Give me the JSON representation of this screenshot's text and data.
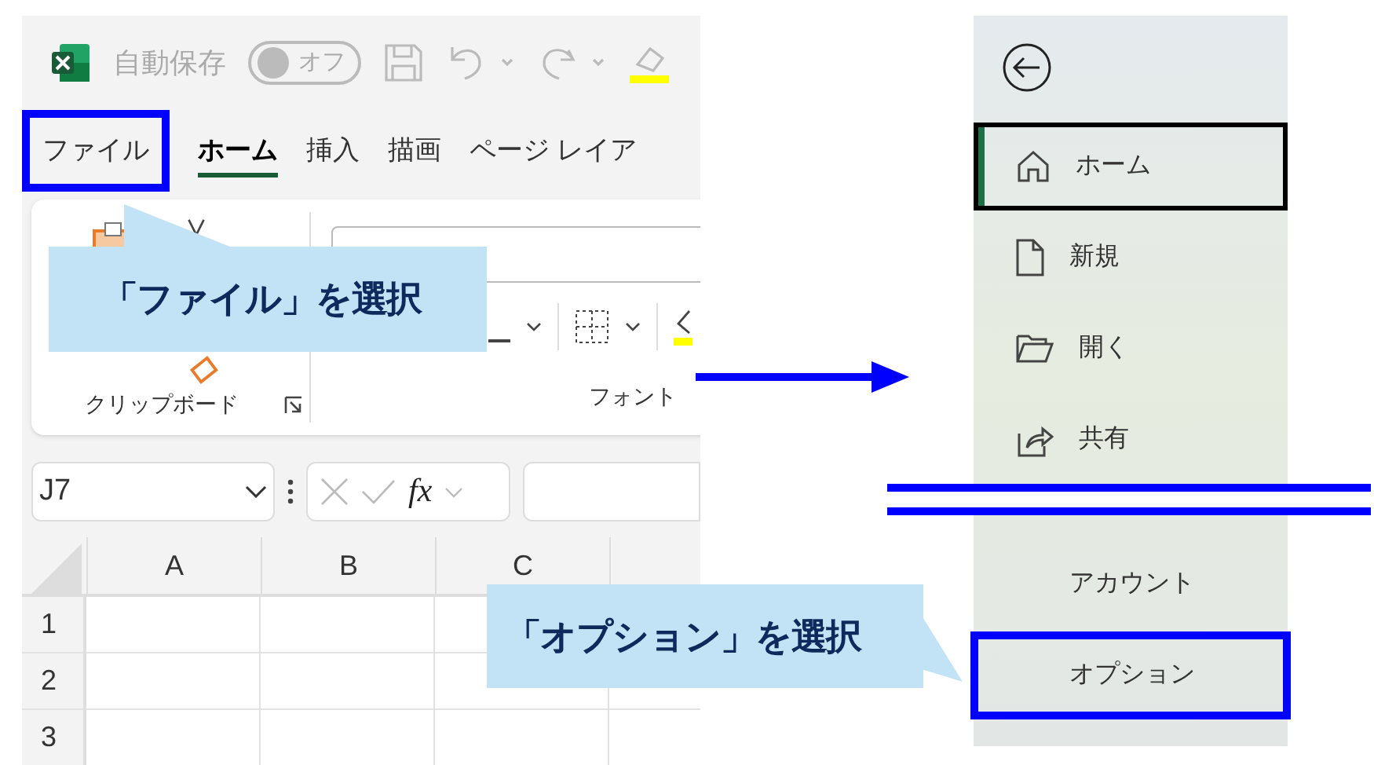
{
  "excel": {
    "autosave": {
      "label": "自動保存",
      "toggle": "オフ",
      "on": false
    },
    "tabs": [
      {
        "label": "ファイル",
        "selected": false,
        "highlighted": true
      },
      {
        "label": "ホーム",
        "selected": true,
        "highlighted": false
      },
      {
        "label": "挿入",
        "selected": false,
        "highlighted": false
      },
      {
        "label": "描画",
        "selected": false,
        "highlighted": false
      },
      {
        "label": "ページ レイア",
        "selected": false,
        "highlighted": false
      }
    ],
    "ribbon_groups": [
      {
        "label": "クリップボード"
      },
      {
        "label": "フォント"
      }
    ],
    "name_box": "J7",
    "formula_button": "fx",
    "columns": [
      "A",
      "B",
      "C"
    ],
    "rows": [
      "1",
      "2",
      "3"
    ]
  },
  "backstage": {
    "items": [
      {
        "label": "ホーム",
        "kind": "home",
        "selected": true,
        "highlighted": false
      },
      {
        "label": "新規",
        "kind": "new",
        "selected": false,
        "highlighted": false
      },
      {
        "label": "開く",
        "kind": "open",
        "selected": false,
        "highlighted": false
      },
      {
        "label": "共有",
        "kind": "share",
        "selected": false,
        "highlighted": false
      },
      {
        "label": "アカウント",
        "kind": "text",
        "selected": false,
        "highlighted": false
      },
      {
        "label": "オプション",
        "kind": "text",
        "selected": false,
        "highlighted": true
      }
    ]
  },
  "callouts": [
    {
      "text": "「ファイル」を選択"
    },
    {
      "text": "「オプション」を選択"
    }
  ]
}
